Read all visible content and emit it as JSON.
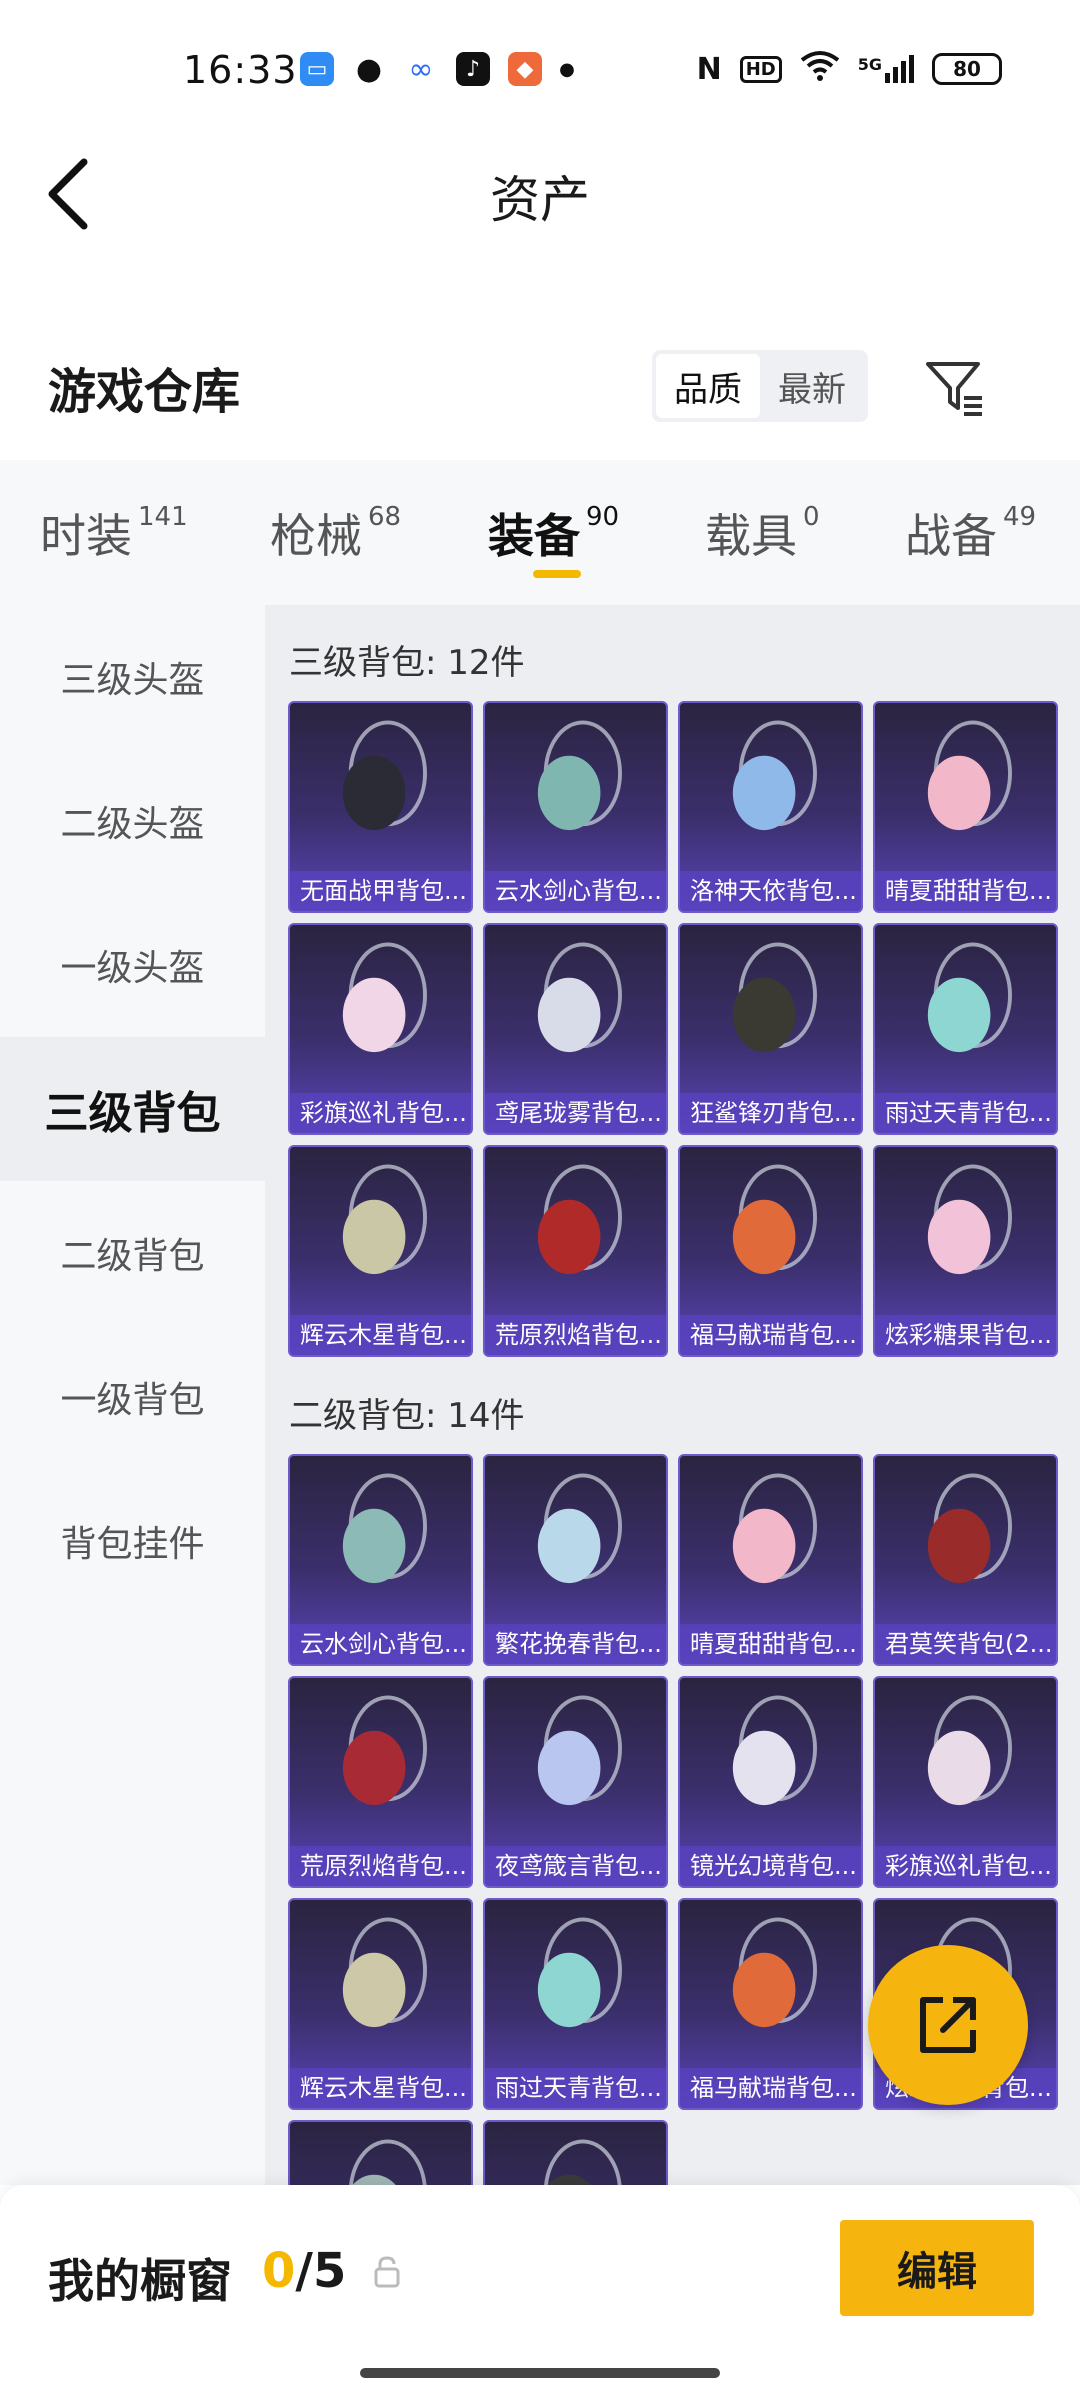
{
  "status_bar": {
    "time": "16:33",
    "apps": [
      "calendar-icon",
      "wechat-icon",
      "baidu-cloud-icon",
      "tiktok-icon",
      "game-icon"
    ],
    "network": "5G",
    "battery": "80",
    "hd_badge": "HD",
    "nfc_label": "N"
  },
  "header": {
    "title": "资产"
  },
  "warehouse": {
    "title": "游戏仓库",
    "sort_options": [
      "品质",
      "最新"
    ],
    "active_sort": "品质"
  },
  "tabs": [
    {
      "label": "时装",
      "count": "141"
    },
    {
      "label": "枪械",
      "count": "68"
    },
    {
      "label": "装备",
      "count": "90"
    },
    {
      "label": "载具",
      "count": "0"
    },
    {
      "label": "战备",
      "count": "49"
    }
  ],
  "active_tab": "装备",
  "side_menu": [
    "三级头盔",
    "二级头盔",
    "一级头盔",
    "三级背包",
    "二级背包",
    "一级背包",
    "背包挂件"
  ],
  "active_side": "三级背包",
  "sections": [
    {
      "title": "三级背包: 12件",
      "items": [
        {
          "name": "无面战甲背包...",
          "color": "#2b2b35"
        },
        {
          "name": "云水剑心背包...",
          "color": "#7fb6b0"
        },
        {
          "name": "洛神天依背包...",
          "color": "#8fb9e8"
        },
        {
          "name": "晴夏甜甜背包...",
          "color": "#f2b7c8"
        },
        {
          "name": "彩旗巡礼背包...",
          "color": "#f0d6e6"
        },
        {
          "name": "鸢尾珑雾背包...",
          "color": "#d8dbe8"
        },
        {
          "name": "狂鲨锋刃背包...",
          "color": "#3a3a32"
        },
        {
          "name": "雨过天青背包...",
          "color": "#8ed6d2"
        },
        {
          "name": "辉云木星背包...",
          "color": "#c9c7a6"
        },
        {
          "name": "荒原烈焰背包...",
          "color": "#b02a2a"
        },
        {
          "name": "福马献瑞背包...",
          "color": "#e06a3a"
        },
        {
          "name": "炫彩糖果背包...",
          "color": "#f2c2d8"
        }
      ]
    },
    {
      "title": "二级背包: 14件",
      "items": [
        {
          "name": "云水剑心背包...",
          "color": "#8cbab6"
        },
        {
          "name": "繁花挽春背包...",
          "color": "#b9d8ea"
        },
        {
          "name": "晴夏甜甜背包...",
          "color": "#f2b7c8"
        },
        {
          "name": "君莫笑背包(2...",
          "color": "#9a2b2b"
        },
        {
          "name": "荒原烈焰背包...",
          "color": "#a82a34"
        },
        {
          "name": "夜鸢箴言背包...",
          "color": "#b9c6f0"
        },
        {
          "name": "镜光幻境背包...",
          "color": "#e5e2ef"
        },
        {
          "name": "彩旗巡礼背包...",
          "color": "#e9dbe8"
        },
        {
          "name": "辉云木星背包...",
          "color": "#cdc9a8"
        },
        {
          "name": "雨过天青背包...",
          "color": "#8ed6d2"
        },
        {
          "name": "福马献瑞背包...",
          "color": "#e06a3a"
        },
        {
          "name": "炫彩糖果背包...",
          "color": "#f2c2d8"
        },
        {
          "name": "",
          "color": "#9fb6b4"
        },
        {
          "name": "",
          "color": "#3a3a3a"
        }
      ]
    }
  ],
  "bottom": {
    "window_label": "我的橱窗",
    "window_used": "0",
    "window_total": "/5",
    "edit_label": "编辑"
  },
  "colors": {
    "accent": "#f6b40f",
    "card_border": "#6e5acb"
  }
}
